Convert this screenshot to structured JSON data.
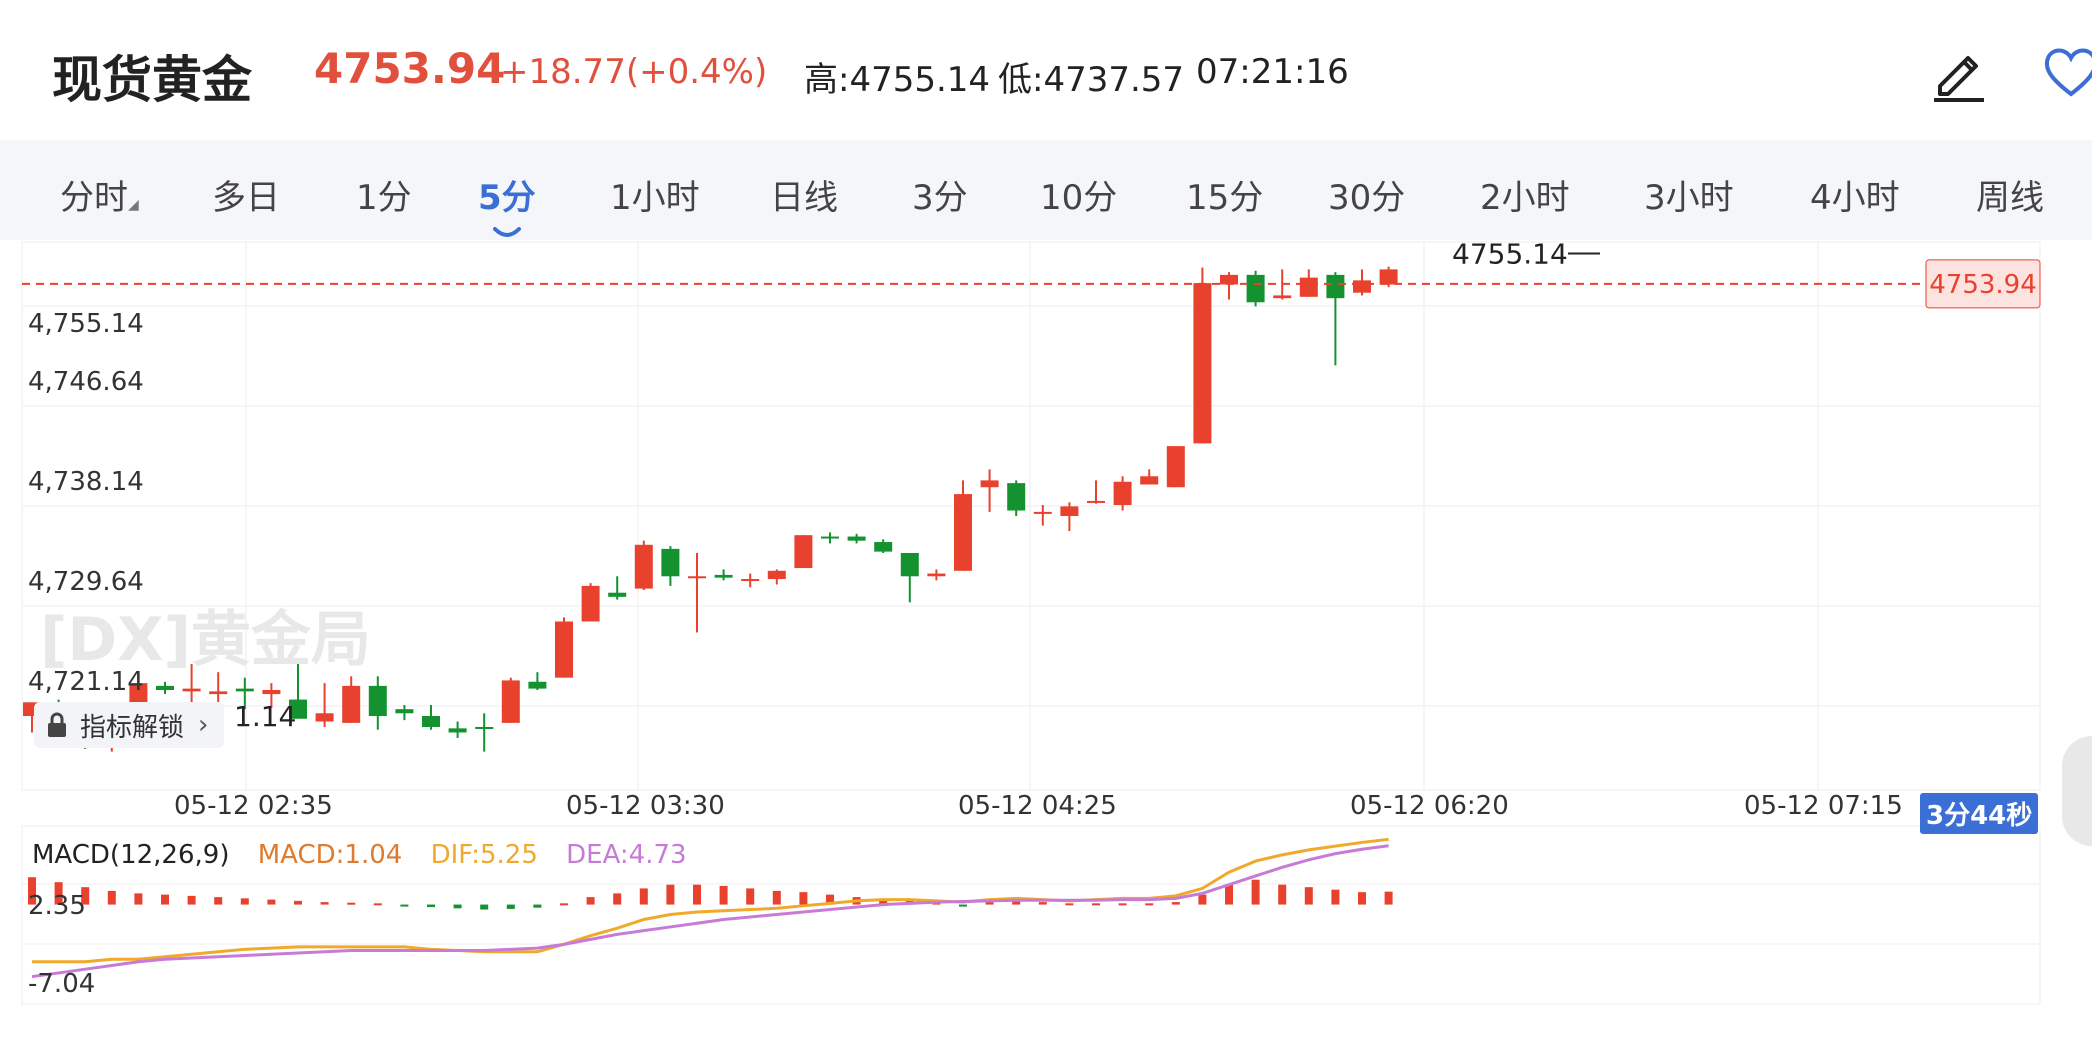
{
  "header": {
    "title": "现货黄金",
    "price": "4753.94",
    "change": "+18.77(+0.4%)",
    "high": "高:4755.14",
    "low": "低:4737.57",
    "time": "07:21:16"
  },
  "tabs": [
    {
      "label": "分时",
      "active": false,
      "has_caret": true
    },
    {
      "label": "多日",
      "active": false
    },
    {
      "label": "1分",
      "active": false
    },
    {
      "label": "5分",
      "active": true
    },
    {
      "label": "1小时",
      "active": false
    },
    {
      "label": "日线",
      "active": false
    },
    {
      "label": "3分",
      "active": false
    },
    {
      "label": "10分",
      "active": false
    },
    {
      "label": "15分",
      "active": false
    },
    {
      "label": "30分",
      "active": false
    },
    {
      "label": "2小时",
      "active": false
    },
    {
      "label": "3小时",
      "active": false
    },
    {
      "label": "4小时",
      "active": false
    },
    {
      "label": "周线",
      "active": false
    }
  ],
  "unlock_label": "指标解锁",
  "low_marker_suffix": "1.14",
  "timer": "3分44秒",
  "colors": {
    "up": "#e8412d",
    "down": "#13922f",
    "accent": "#3b6fd6",
    "macd_line": "#f0a92a",
    "dea_line": "#c77bd6"
  },
  "chart_data": {
    "type": "candlestick",
    "y_ticks": [
      "4,755.14",
      "4,746.64",
      "4,738.14",
      "4,729.64",
      "4,721.14"
    ],
    "ylim": [
      4717,
      4757
    ],
    "x_ticks": [
      "05-12 02:35",
      "05-12 03:30",
      "05-12 04:25",
      "05-12 06:20",
      "05-12 07:15"
    ],
    "last_price_label": "4753.94",
    "last_price": 4753.94,
    "high_label": "4755.14",
    "high_value": 4755.14,
    "candles": [
      {
        "o": 4722.4,
        "h": 4723.4,
        "l": 4721.2,
        "c": 4723.4
      },
      {
        "o": 4723.4,
        "h": 4723.6,
        "l": 4720.6,
        "c": 4721.6
      },
      {
        "o": 4722.2,
        "h": 4722.6,
        "l": 4720.0,
        "c": 4721.8
      },
      {
        "o": 4722.0,
        "h": 4722.8,
        "l": 4719.8,
        "c": 4722.2
      },
      {
        "o": 4721.8,
        "h": 4725.0,
        "l": 4721.8,
        "c": 4724.8
      },
      {
        "o": 4724.6,
        "h": 4724.9,
        "l": 4724.0,
        "c": 4724.3
      },
      {
        "o": 4724.2,
        "h": 4726.2,
        "l": 4723.2,
        "c": 4724.4
      },
      {
        "o": 4724.0,
        "h": 4725.6,
        "l": 4722.8,
        "c": 4724.2
      },
      {
        "o": 4724.4,
        "h": 4725.2,
        "l": 4722.9,
        "c": 4724.2
      },
      {
        "o": 4724.0,
        "h": 4724.8,
        "l": 4723.0,
        "c": 4724.3
      },
      {
        "o": 4723.6,
        "h": 4726.2,
        "l": 4722.4,
        "c": 4722.2
      },
      {
        "o": 4722.0,
        "h": 4724.8,
        "l": 4721.6,
        "c": 4722.6
      },
      {
        "o": 4721.9,
        "h": 4725.3,
        "l": 4721.9,
        "c": 4724.6
      },
      {
        "o": 4724.6,
        "h": 4725.3,
        "l": 4721.4,
        "c": 4722.4
      },
      {
        "o": 4722.9,
        "h": 4723.2,
        "l": 4722.1,
        "c": 4722.6
      },
      {
        "o": 4722.4,
        "h": 4723.2,
        "l": 4721.4,
        "c": 4721.6
      },
      {
        "o": 4721.5,
        "h": 4722.0,
        "l": 4720.8,
        "c": 4721.2
      },
      {
        "o": 4721.6,
        "h": 4722.6,
        "l": 4719.8,
        "c": 4721.5
      },
      {
        "o": 4721.9,
        "h": 4725.2,
        "l": 4721.9,
        "c": 4725.0
      },
      {
        "o": 4724.9,
        "h": 4725.6,
        "l": 4724.3,
        "c": 4724.4
      },
      {
        "o": 4725.2,
        "h": 4729.6,
        "l": 4725.2,
        "c": 4729.3
      },
      {
        "o": 4729.3,
        "h": 4732.1,
        "l": 4729.3,
        "c": 4731.9
      },
      {
        "o": 4731.4,
        "h": 4732.6,
        "l": 4730.9,
        "c": 4731.1
      },
      {
        "o": 4731.7,
        "h": 4735.2,
        "l": 4731.6,
        "c": 4734.9
      },
      {
        "o": 4734.6,
        "h": 4734.8,
        "l": 4731.9,
        "c": 4732.6
      },
      {
        "o": 4732.6,
        "h": 4734.3,
        "l": 4728.5,
        "c": 4732.6
      },
      {
        "o": 4732.7,
        "h": 4733.1,
        "l": 4732.3,
        "c": 4732.5
      },
      {
        "o": 4732.4,
        "h": 4732.8,
        "l": 4731.8,
        "c": 4732.4
      },
      {
        "o": 4732.4,
        "h": 4733.1,
        "l": 4732.0,
        "c": 4733.0
      },
      {
        "o": 4733.2,
        "h": 4735.6,
        "l": 4733.2,
        "c": 4735.6
      },
      {
        "o": 4735.5,
        "h": 4735.8,
        "l": 4735.0,
        "c": 4735.4
      },
      {
        "o": 4735.5,
        "h": 4735.7,
        "l": 4735.0,
        "c": 4735.2
      },
      {
        "o": 4735.1,
        "h": 4735.3,
        "l": 4734.3,
        "c": 4734.4
      },
      {
        "o": 4734.3,
        "h": 4734.3,
        "l": 4730.7,
        "c": 4732.6
      },
      {
        "o": 4732.6,
        "h": 4733.1,
        "l": 4732.3,
        "c": 4732.8
      },
      {
        "o": 4733.0,
        "h": 4739.6,
        "l": 4733.0,
        "c": 4738.6
      },
      {
        "o": 4739.1,
        "h": 4740.4,
        "l": 4737.3,
        "c": 4739.6
      },
      {
        "o": 4739.4,
        "h": 4739.6,
        "l": 4737.0,
        "c": 4737.4
      },
      {
        "o": 4737.3,
        "h": 4737.8,
        "l": 4736.3,
        "c": 4737.3
      },
      {
        "o": 4737.0,
        "h": 4738.0,
        "l": 4735.9,
        "c": 4737.7
      },
      {
        "o": 4738.0,
        "h": 4739.6,
        "l": 4737.9,
        "c": 4738.1
      },
      {
        "o": 4737.8,
        "h": 4739.9,
        "l": 4737.4,
        "c": 4739.5
      },
      {
        "o": 4739.3,
        "h": 4740.4,
        "l": 4739.3,
        "c": 4739.9
      },
      {
        "o": 4739.1,
        "h": 4742.1,
        "l": 4739.1,
        "c": 4742.1
      },
      {
        "o": 4742.3,
        "h": 4755.14,
        "l": 4742.3,
        "c": 4754.0
      },
      {
        "o": 4753.9,
        "h": 4754.8,
        "l": 4752.8,
        "c": 4754.6
      },
      {
        "o": 4754.6,
        "h": 4754.9,
        "l": 4752.3,
        "c": 4752.6
      },
      {
        "o": 4752.9,
        "h": 4755.0,
        "l": 4752.8,
        "c": 4753.1
      },
      {
        "o": 4753.0,
        "h": 4755.0,
        "l": 4753.0,
        "c": 4754.4
      },
      {
        "o": 4754.6,
        "h": 4754.8,
        "l": 4748.0,
        "c": 4752.9
      },
      {
        "o": 4753.3,
        "h": 4755.0,
        "l": 4753.1,
        "c": 4754.2
      },
      {
        "o": 4753.9,
        "h": 4755.2,
        "l": 4753.7,
        "c": 4755.0
      }
    ]
  },
  "macd": {
    "legend": {
      "name": "MACD(12,26,9)",
      "macd": "MACD:1.04",
      "dif": "DIF:5.25",
      "dea": "DEA:4.73"
    },
    "y_ticks": [
      "2.35",
      "-7.04"
    ],
    "ylim": [
      -8,
      6
    ],
    "dif": [
      -4.6,
      -4.6,
      -4.6,
      -4.4,
      -4.4,
      -4.2,
      -4.0,
      -3.8,
      -3.6,
      -3.5,
      -3.4,
      -3.4,
      -3.4,
      -3.4,
      -3.4,
      -3.6,
      -3.7,
      -3.8,
      -3.8,
      -3.8,
      -3.2,
      -2.5,
      -1.9,
      -1.2,
      -0.8,
      -0.6,
      -0.5,
      -0.4,
      -0.3,
      -0.1,
      0.1,
      0.3,
      0.4,
      0.4,
      0.3,
      0.2,
      0.4,
      0.5,
      0.4,
      0.3,
      0.4,
      0.5,
      0.5,
      0.7,
      1.3,
      2.6,
      3.5,
      4.0,
      4.4,
      4.7,
      5.0,
      5.25
    ],
    "dea": [
      -5.8,
      -5.5,
      -5.2,
      -4.9,
      -4.6,
      -4.4,
      -4.3,
      -4.2,
      -4.1,
      -4.0,
      -3.9,
      -3.8,
      -3.7,
      -3.7,
      -3.7,
      -3.7,
      -3.7,
      -3.7,
      -3.6,
      -3.5,
      -3.2,
      -2.8,
      -2.4,
      -2.1,
      -1.8,
      -1.5,
      -1.2,
      -1.0,
      -0.8,
      -0.6,
      -0.4,
      -0.2,
      0.0,
      0.1,
      0.2,
      0.25,
      0.3,
      0.35,
      0.35,
      0.35,
      0.35,
      0.4,
      0.4,
      0.5,
      0.9,
      1.6,
      2.3,
      3.0,
      3.6,
      4.1,
      4.45,
      4.73
    ],
    "hist": [
      2.2,
      1.8,
      1.4,
      1.1,
      0.9,
      0.8,
      0.7,
      0.6,
      0.5,
      0.4,
      0.3,
      0.2,
      0.15,
      0.1,
      -0.1,
      -0.2,
      -0.3,
      -0.4,
      -0.35,
      -0.25,
      0.1,
      0.6,
      0.9,
      1.3,
      1.6,
      1.6,
      1.5,
      1.3,
      1.1,
      1.0,
      0.8,
      0.6,
      0.4,
      0.3,
      0.2,
      -0.1,
      0.2,
      0.3,
      0.2,
      0.1,
      0.1,
      0.1,
      0.1,
      0.2,
      0.8,
      1.6,
      2.0,
      1.6,
      1.4,
      1.2,
      1.0,
      1.04
    ]
  }
}
